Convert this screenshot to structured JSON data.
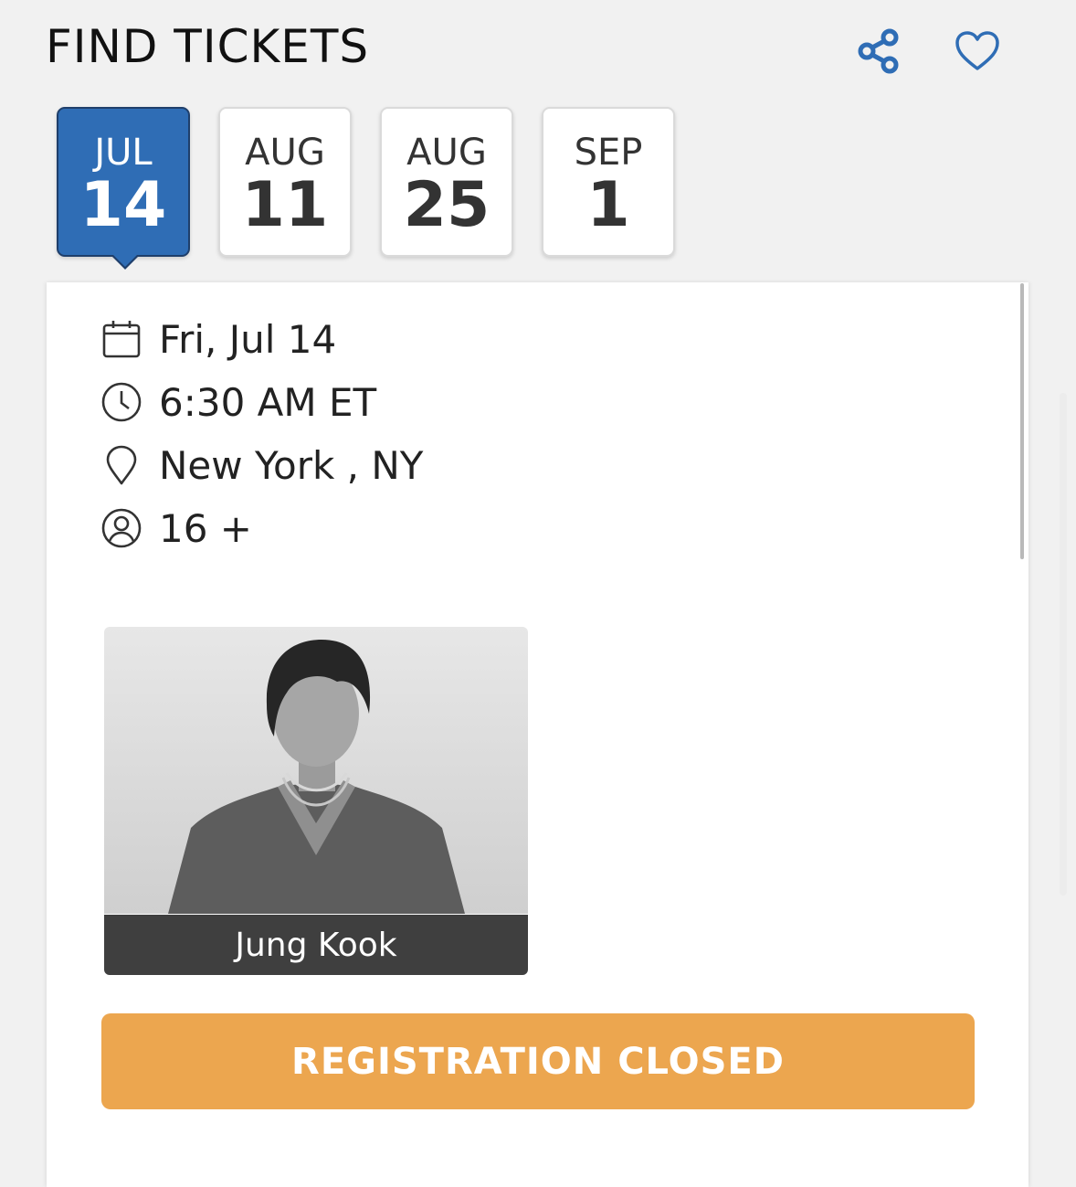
{
  "header": {
    "title": "FIND TICKETS",
    "share_icon": "share-icon",
    "favorite_icon": "heart-icon",
    "accent_color": "#2f6db5"
  },
  "date_tabs": [
    {
      "month": "JUL",
      "day": "14",
      "selected": true
    },
    {
      "month": "AUG",
      "day": "11",
      "selected": false
    },
    {
      "month": "AUG",
      "day": "25",
      "selected": false
    },
    {
      "month": "SEP",
      "day": "1",
      "selected": false
    }
  ],
  "event": {
    "date": "Fri, Jul 14",
    "time": "6:30 AM ET",
    "location": "New York , NY",
    "age": "16 +"
  },
  "artist": {
    "name": "Jung Kook"
  },
  "registration": {
    "label": "REGISTRATION CLOSED",
    "color": "#eca64f"
  }
}
